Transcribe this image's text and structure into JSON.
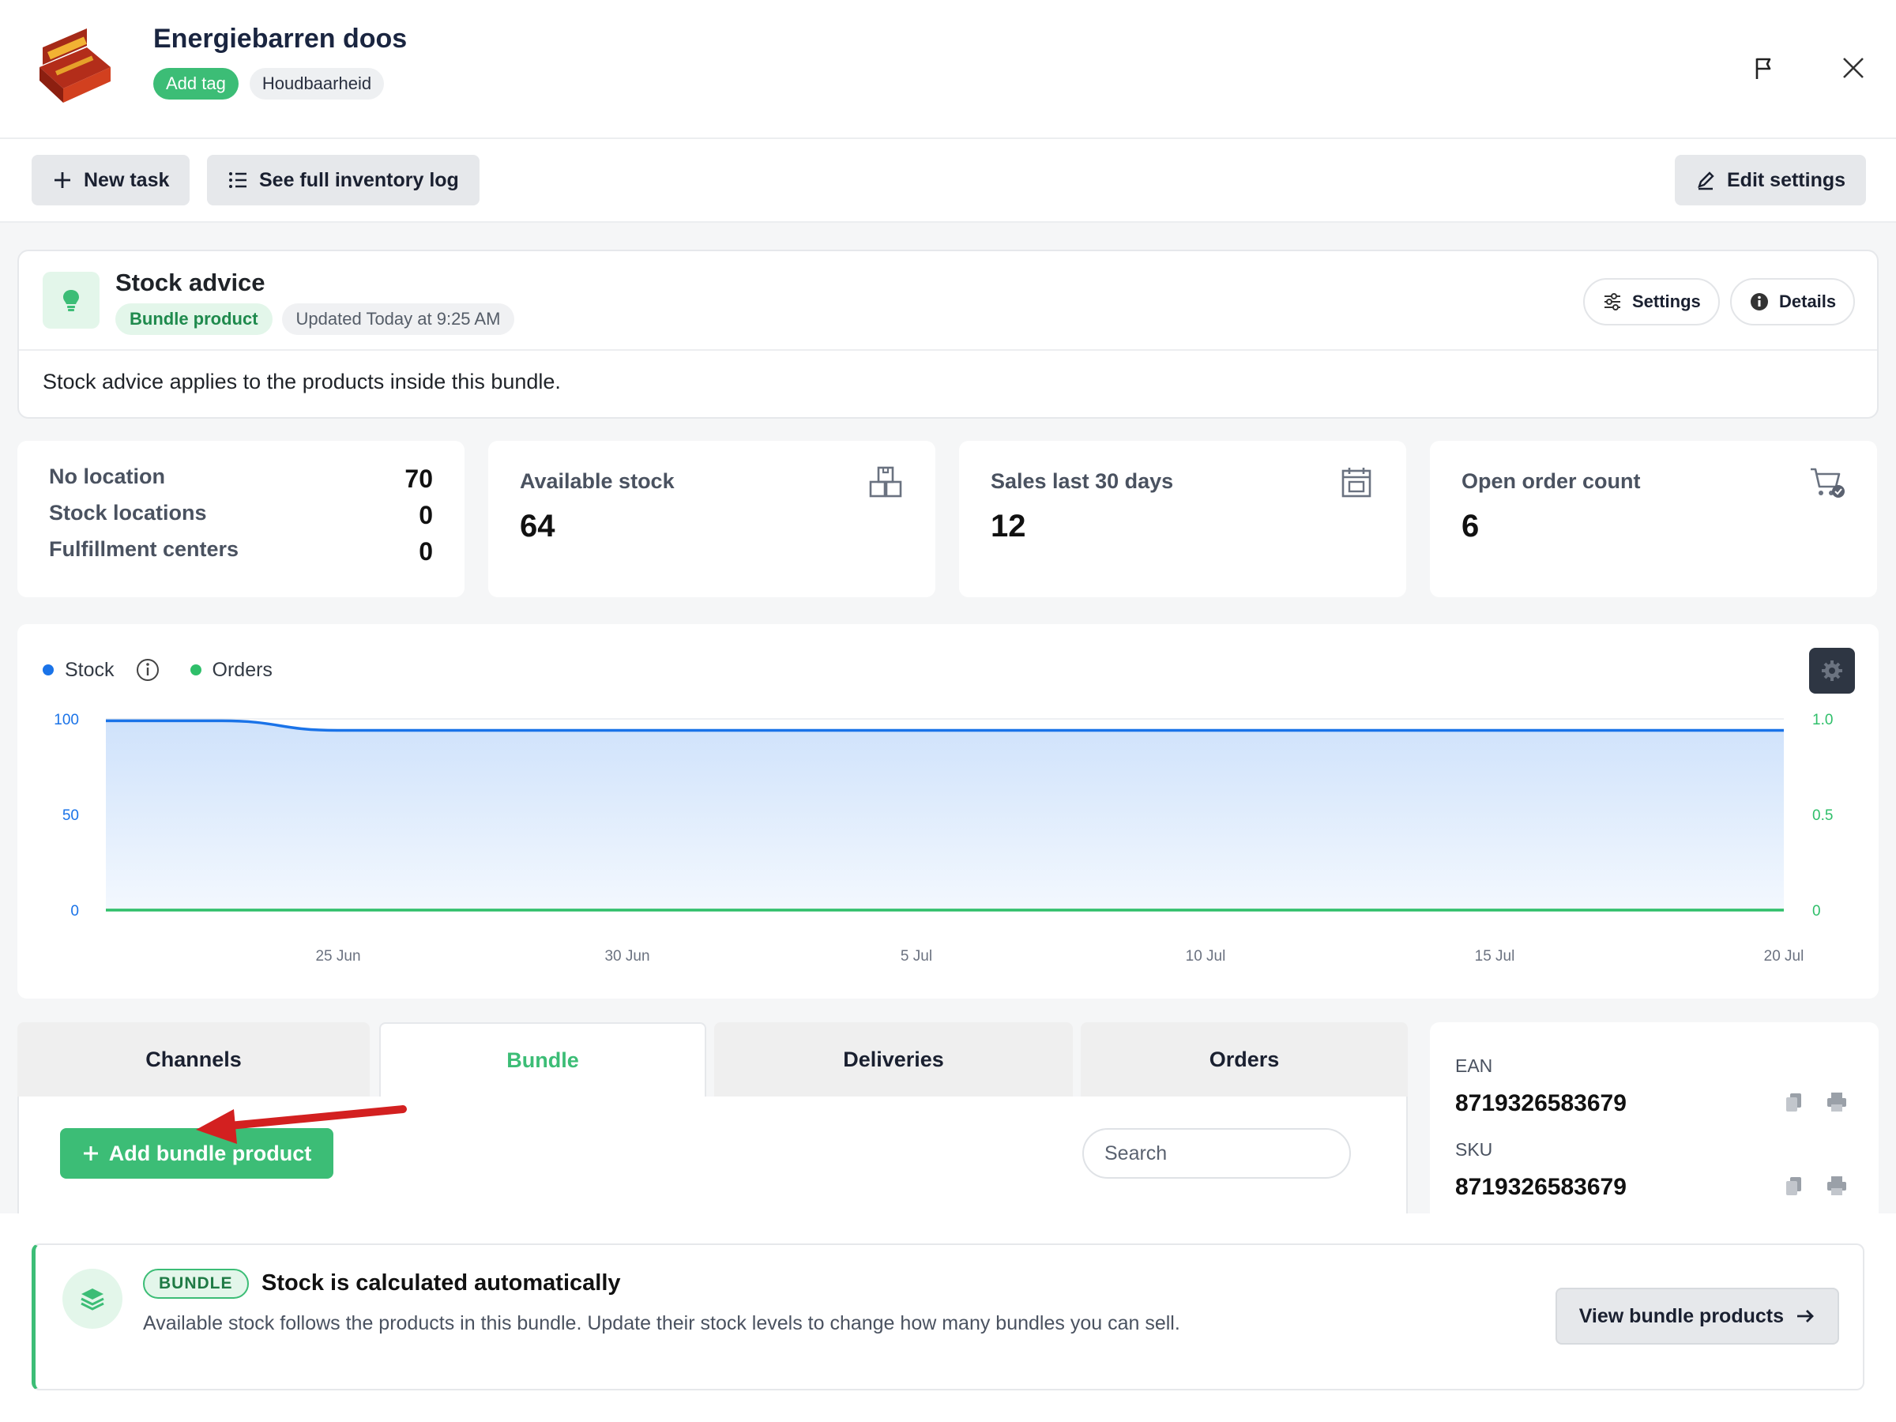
{
  "header": {
    "title": "Energiebarren doos",
    "add_tag_label": "Add tag",
    "tags": [
      "Houdbaarheid"
    ],
    "product_image": "product-box-image",
    "icons": [
      "flag-icon",
      "close-icon"
    ]
  },
  "toolbar": {
    "new_task_label": "New task",
    "inventory_log_label": "See full inventory log",
    "edit_settings_label": "Edit settings"
  },
  "stock_advice": {
    "title": "Stock advice",
    "badge": "Bundle product",
    "updated": "Updated Today at 9:25 AM",
    "settings_label": "Settings",
    "details_label": "Details",
    "message": "Stock advice applies to the products inside this bundle.",
    "icon": "lightbulb-icon"
  },
  "locations": [
    {
      "label": "No location",
      "value": "70"
    },
    {
      "label": "Stock locations",
      "value": "0"
    },
    {
      "label": "Fulfillment centers",
      "value": "0"
    }
  ],
  "stats": {
    "available": {
      "label": "Available stock",
      "value": "64",
      "icon": "warehouse-icon"
    },
    "sales": {
      "label": "Sales last 30 days",
      "value": "12",
      "icon": "calendar-icon"
    },
    "orders": {
      "label": "Open order count",
      "value": "6",
      "icon": "cart-check-icon"
    }
  },
  "colors": {
    "accent_green": "#3cbd76",
    "stock_blue": "#1a73e8",
    "orders_green": "#2fbf6a"
  },
  "chart_data": {
    "type": "area",
    "title": "",
    "legend": [
      "Stock",
      "Orders"
    ],
    "legend_position": "top-left",
    "x_ticks": [
      "25 Jun",
      "30 Jun",
      "5 Jul",
      "10 Jul",
      "15 Jul",
      "20 Jul"
    ],
    "y_left_ticks": [
      "100",
      "50",
      "0"
    ],
    "y_right_ticks": [
      "1.0",
      "0.5",
      "0"
    ],
    "ylim_left": [
      0,
      100
    ],
    "ylim_right": [
      0,
      1
    ],
    "xlim": [
      "2024-06-21",
      "2024-07-20"
    ],
    "grid": true,
    "series": [
      {
        "name": "Stock",
        "axis": "left",
        "x": [
          "2024-06-21",
          "2024-06-23",
          "2024-06-25",
          "2024-06-27",
          "2024-07-20"
        ],
        "values": [
          99,
          99,
          94,
          94,
          94
        ]
      },
      {
        "name": "Orders",
        "axis": "right",
        "x": [
          "2024-06-21",
          "2024-07-20"
        ],
        "values": [
          0,
          0
        ]
      }
    ]
  },
  "tabs": [
    {
      "label": "Channels"
    },
    {
      "label": "Bundle"
    },
    {
      "label": "Deliveries"
    },
    {
      "label": "Orders"
    }
  ],
  "bundle_tab": {
    "add_button_label": "Add bundle product",
    "search_placeholder": "Search"
  },
  "codes": {
    "ean_label": "EAN",
    "ean_value": "8719326583679",
    "sku_label": "SKU",
    "sku_value": "8719326583679"
  },
  "bundle_notice": {
    "pill": "BUNDLE",
    "title": "Stock is calculated automatically",
    "text": "Available stock follows the products in this bundle. Update their stock levels to change how many bundles you can sell.",
    "button_label": "View bundle products"
  }
}
